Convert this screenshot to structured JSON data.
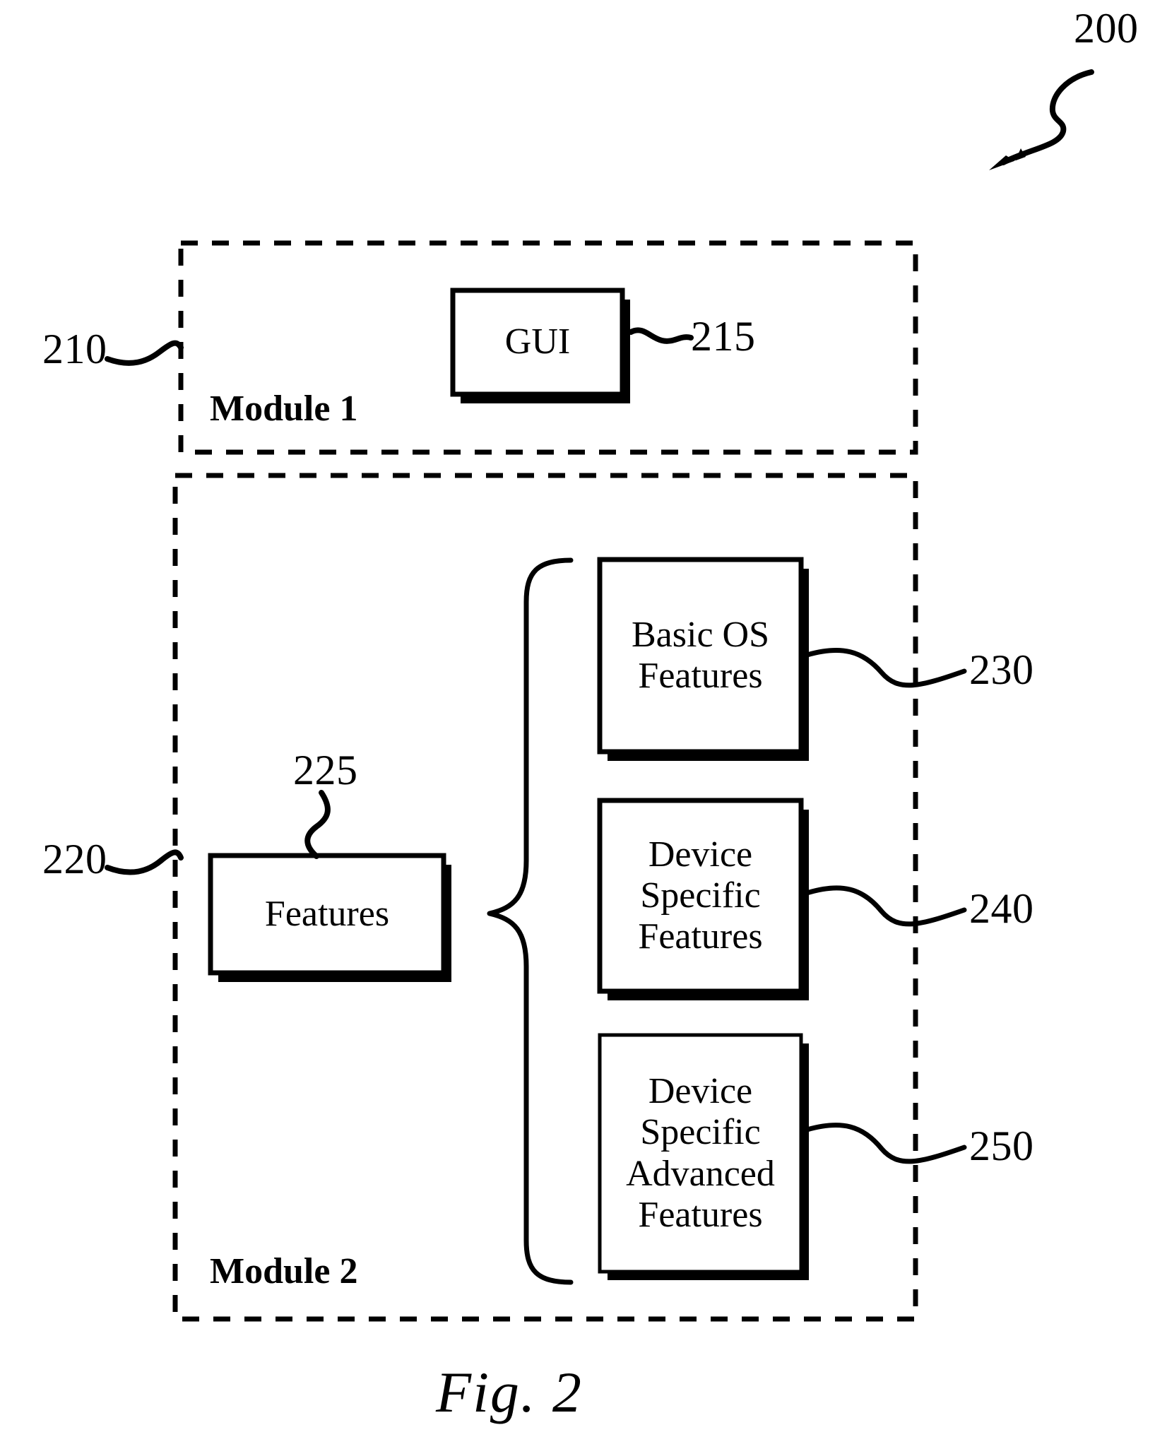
{
  "figure": {
    "caption": "Fig. 2",
    "system_ref": "200"
  },
  "modules": [
    {
      "name": "Module 1",
      "ref": "210",
      "components": [
        {
          "label_lines": [
            "GUI"
          ],
          "ref": "215"
        }
      ]
    },
    {
      "name": "Module 2",
      "ref": "220",
      "components": [
        {
          "label_lines": [
            "Features"
          ],
          "ref": "225"
        },
        {
          "label_lines": [
            "Basic OS",
            "Features"
          ],
          "ref": "230"
        },
        {
          "label_lines": [
            "Device",
            "Specific",
            "Features"
          ],
          "ref": "240"
        },
        {
          "label_lines": [
            "Device",
            "Specific",
            "Advanced",
            "Features"
          ],
          "ref": "250"
        }
      ]
    }
  ],
  "boxes": {
    "gui": {
      "line1": "GUI"
    },
    "features": {
      "line1": "Features"
    },
    "basic_os": {
      "line1": "Basic OS",
      "line2": "Features"
    },
    "device_specific": {
      "line1": "Device",
      "line2": "Specific",
      "line3": "Features"
    },
    "device_advanced": {
      "line1": "Device",
      "line2": "Specific",
      "line3": "Advanced",
      "line4": "Features"
    }
  },
  "refs": {
    "system": "200",
    "module1": "210",
    "gui": "215",
    "module2": "220",
    "features": "225",
    "basic_os": "230",
    "device_specific": "240",
    "device_advanced": "250"
  },
  "labels": {
    "module1_name": "Module 1",
    "module2_name": "Module 2",
    "fig_caption": "Fig. 2"
  },
  "colors": {
    "ink": "#000000",
    "paper": "#ffffff"
  }
}
